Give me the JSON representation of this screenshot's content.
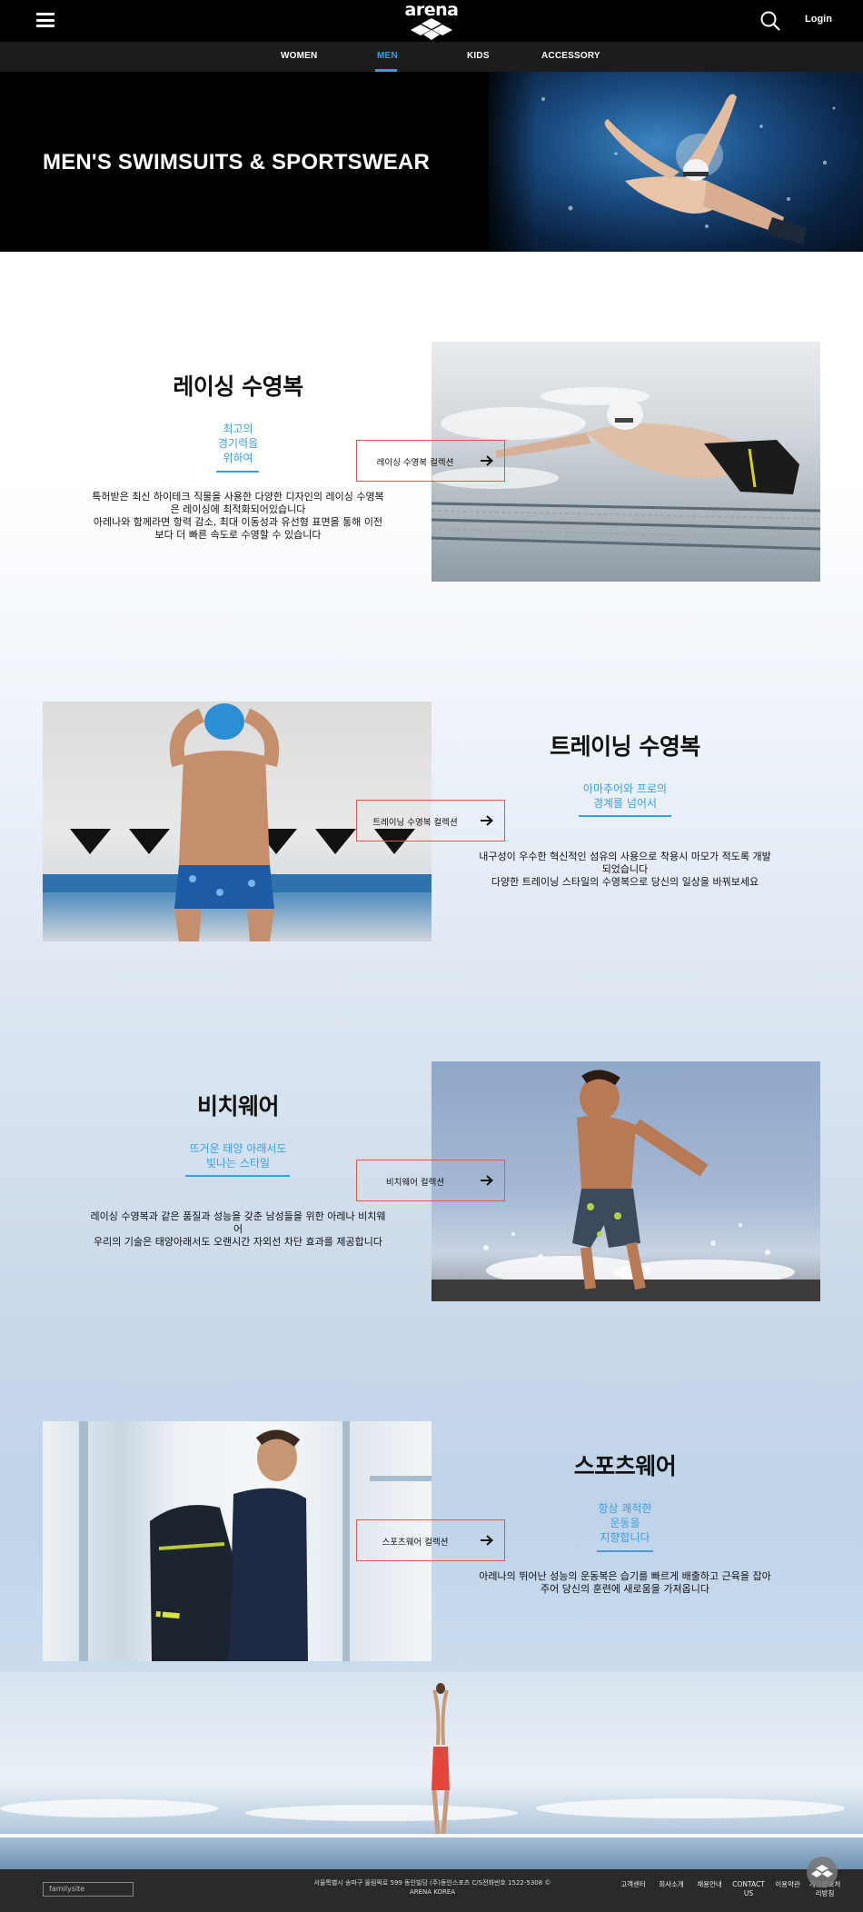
{
  "header": {
    "logo_text": "arena",
    "login_label": "Login",
    "nav": [
      {
        "label": "WOMEN"
      },
      {
        "label": "MEN"
      },
      {
        "label": "KIDS"
      },
      {
        "label": "ACCESSORY"
      }
    ],
    "active_nav": "MEN",
    "accent_color": "#2d9fe2"
  },
  "hero": {
    "title": "MEN'S SWIMSUITS & SPORTSWEAR"
  },
  "sections": [
    {
      "title": "레이싱 수영복",
      "subtitle_lines": [
        "최고의",
        "경기력을",
        "위하여"
      ],
      "description_lines": [
        "특허받은 최신 하이테크 직물을 사용한 다양한 디자인의 레이싱 수영복",
        "은 레이싱에 최적화되어있습니다",
        "아레나와 함께라면 항력 감소, 최대 이동성과 유선형 표면을 통해 이전",
        "보다 더 빠른 속도로 수영할 수 있습니다"
      ],
      "cta_label": "레이싱 수영복 컬렉션"
    },
    {
      "title": "트레이닝 수영복",
      "subtitle_lines": [
        "아마추어와 프로의",
        "경계를 넘어서"
      ],
      "description_lines": [
        "내구성이 우수한 혁신적인 섬유의 사용으로 착용시 마모가 적도록 개발",
        "되었습니다",
        "다양한 트레이닝 스타일의 수영복으로 당신의 일상을 바꿔보세요"
      ],
      "cta_label": "트레이닝 수영복 컬렉션"
    },
    {
      "title": "비치웨어",
      "subtitle_lines": [
        "뜨거운 태양 아래서도",
        "빛나는 스타일"
      ],
      "description_lines": [
        "레이싱 수영복과 같은 품질과 성능을 갖춘 남성들을 위한 아레나 비치웨",
        "어",
        "우리의 기술은 태양아래서도 오랜시간 자외선 차단 효과를 제공합니다"
      ],
      "cta_label": "비치웨어 컬렉션"
    },
    {
      "title": "스포츠웨어",
      "subtitle_lines": [
        "항상 쾌적한",
        "운동을",
        "지향합니다"
      ],
      "description_lines": [
        "아레나의 뛰어난 성능의 운동복은 습기를 빠르게 배출하고 근육을 잡아",
        "주어 당신의 훈련에 새로움을 가져옵니다"
      ],
      "cta_label": "스포츠웨어 컬렉션"
    }
  ],
  "footer": {
    "familysite_label": "familysite",
    "address_lines": [
      "서울특별시 송파구 올림픽로 599 동인빌딩 (주)동인스포츠 C/S전화번호 1522-5308 ©",
      "ARENA KOREA"
    ],
    "links": [
      "고객센터",
      "회사소개",
      "채용안내",
      "CONTACT US",
      "이용약관",
      "개인정보처리방침"
    ]
  },
  "icons": [
    "menu-icon",
    "search-icon",
    "arrow-right-icon",
    "scroll-top-icon"
  ]
}
